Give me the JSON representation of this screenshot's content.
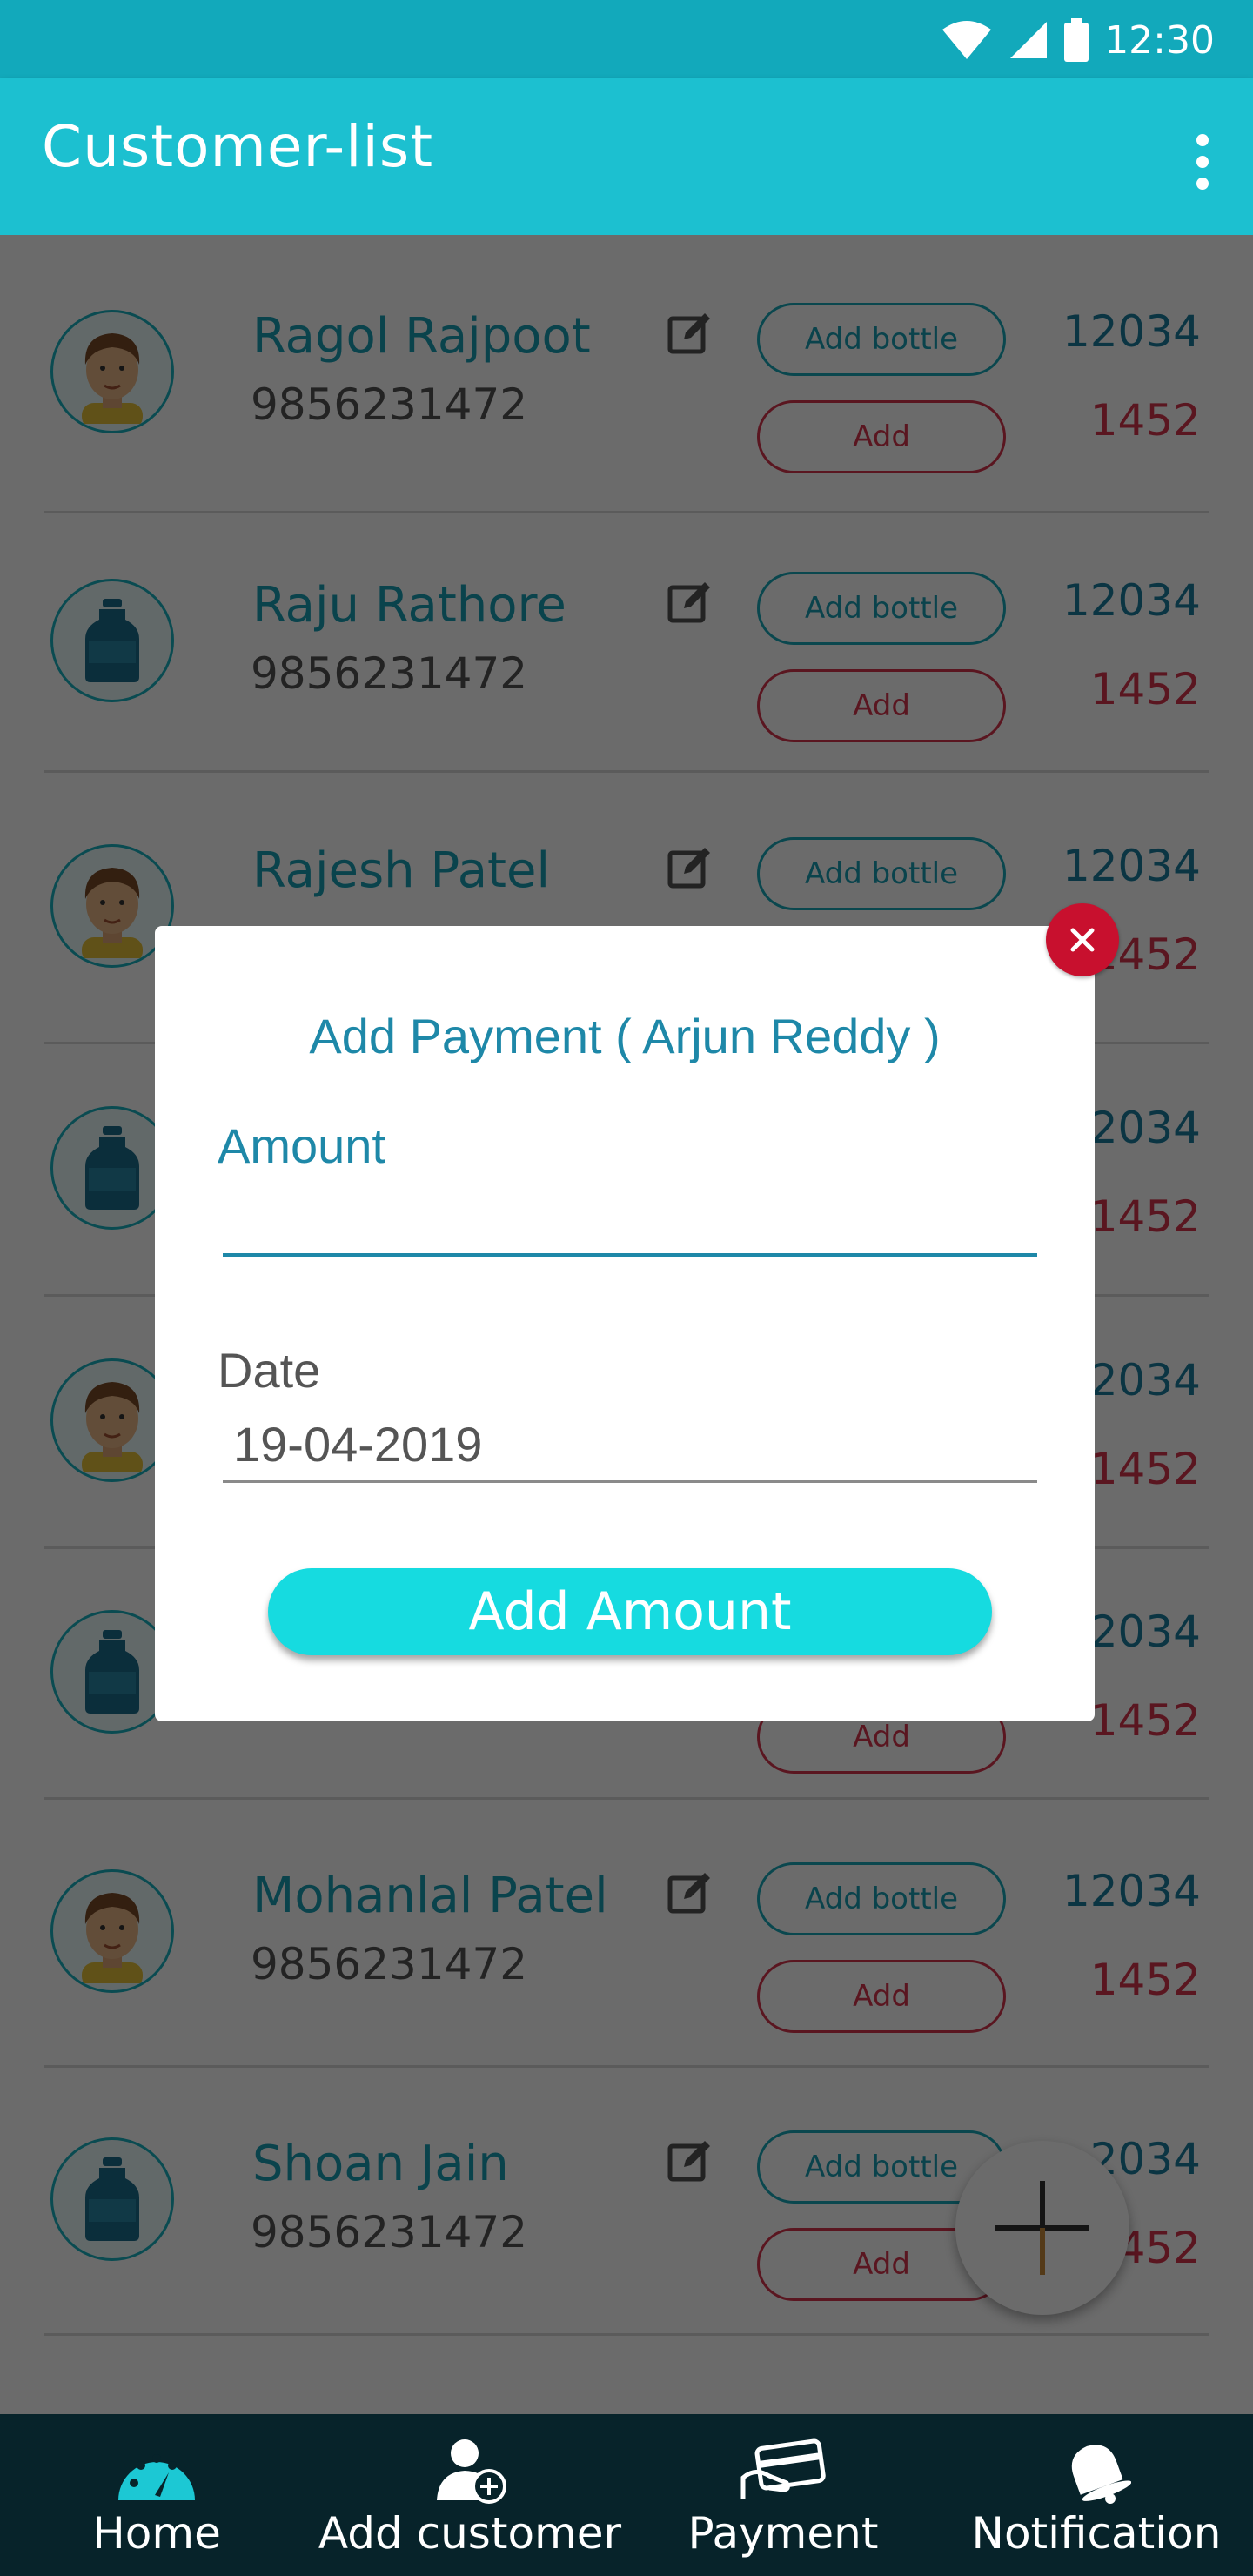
{
  "status_bar": {
    "time": "12:30"
  },
  "app_bar": {
    "title": "Customer-list"
  },
  "customers": [
    {
      "name": "Ragol Rajpoot",
      "phone": "9856231472",
      "avatar": "man",
      "add_bottle_label": "Add bottle",
      "add_label": "Add",
      "top_number": "12034",
      "bottom_number": "1452"
    },
    {
      "name": "Raju Rathore",
      "phone": "9856231472",
      "avatar": "bottle",
      "add_bottle_label": "Add bottle",
      "add_label": "Add",
      "top_number": "12034",
      "bottom_number": "1452"
    },
    {
      "name": "Rajesh Patel",
      "phone": "",
      "avatar": "man",
      "add_bottle_label": "Add bottle",
      "add_label": "",
      "top_number": "12034",
      "bottom_number": "1452"
    },
    {
      "name": "",
      "phone": "",
      "avatar": "bottle",
      "add_bottle_label": "",
      "add_label": "",
      "top_number": "2034",
      "bottom_number": "1452"
    },
    {
      "name": "",
      "phone": "",
      "avatar": "man",
      "add_bottle_label": "",
      "add_label": "",
      "top_number": "2034",
      "bottom_number": "1452"
    },
    {
      "name": "",
      "phone": "",
      "avatar": "bottle",
      "add_bottle_label": "",
      "add_label": "Add",
      "top_number": "2034",
      "bottom_number": "1452"
    },
    {
      "name": "Mohanlal Patel",
      "phone": "9856231472",
      "avatar": "man",
      "add_bottle_label": "Add bottle",
      "add_label": "Add",
      "top_number": "12034",
      "bottom_number": "1452"
    },
    {
      "name": "Shoan Jain",
      "phone": "9856231472",
      "avatar": "bottle",
      "add_bottle_label": "Add bottle",
      "add_label": "Add",
      "top_number": "2034",
      "bottom_number": "452"
    }
  ],
  "dialog": {
    "title": "Add Payment  ( Arjun Reddy )",
    "amount_label": "Amount",
    "amount_value": "",
    "date_label": "Date",
    "date_value": "19-04-2019",
    "submit_label": "Add Amount"
  },
  "bottom_nav": [
    {
      "label": "Home",
      "icon": "speedometer-icon",
      "active": true
    },
    {
      "label": "Add customer",
      "icon": "add-user-icon",
      "active": false
    },
    {
      "label": "Payment",
      "icon": "payment-card-icon",
      "active": false
    },
    {
      "label": "Notification",
      "icon": "bell-icon",
      "active": false
    }
  ],
  "colors": {
    "status_bar": "#12a9bb",
    "app_bar": "#1cc0d0",
    "accent": "#16dbe0",
    "danger": "#d6354e",
    "close": "#c8102e",
    "nav_bg": "#07232a"
  }
}
